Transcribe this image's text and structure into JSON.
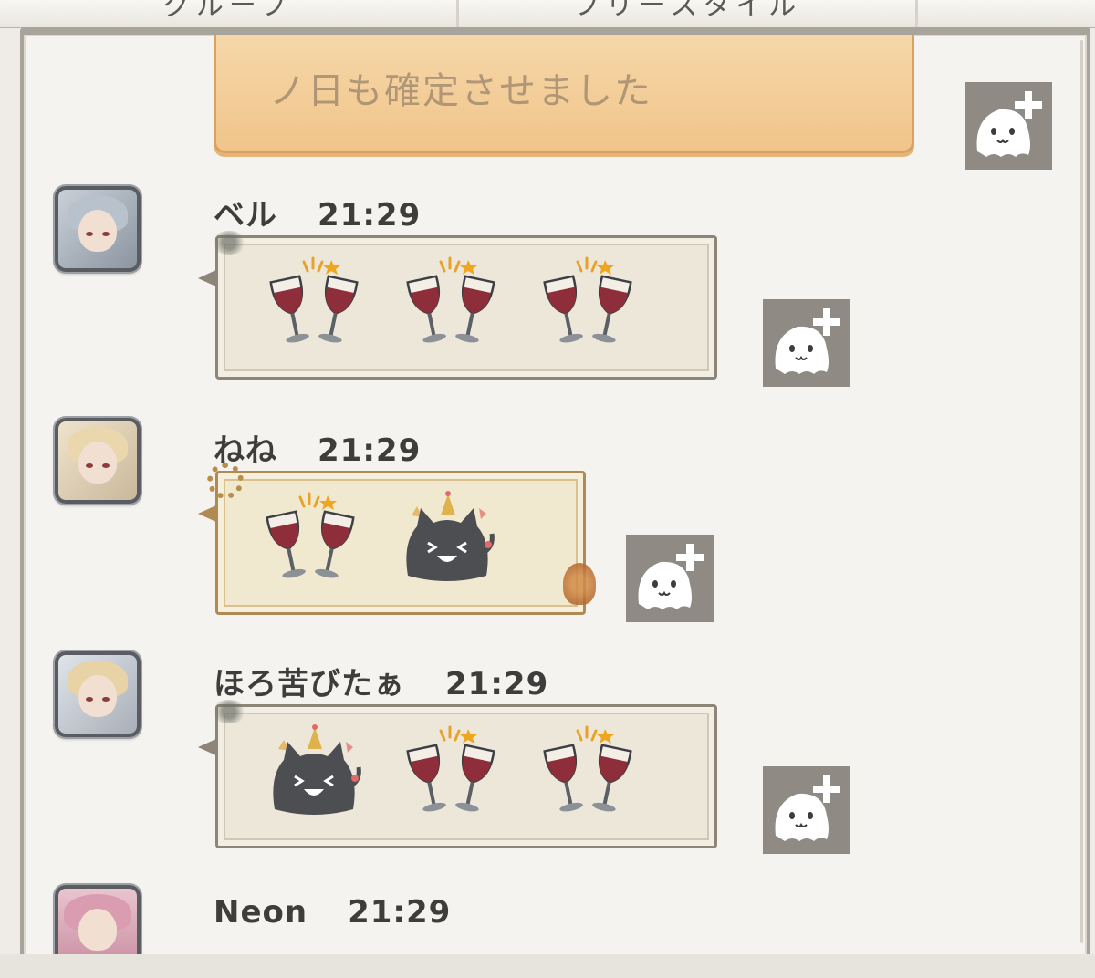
{
  "tabs": [
    {
      "label": "グループ"
    },
    {
      "label": "フリースタイル"
    },
    {
      "label": ""
    }
  ],
  "previous_message": {
    "text": "ノ日も確定させました"
  },
  "messages": [
    {
      "sender": "ベル",
      "time": "21:29",
      "stamps": [
        "wine-toast-stamp",
        "wine-toast-stamp",
        "wine-toast-stamp"
      ]
    },
    {
      "sender": "ねね",
      "time": "21:29",
      "stamps": [
        "wine-toast-stamp",
        "party-cat-stamp"
      ]
    },
    {
      "sender": "ほろ苦びたぁ",
      "time": "21:29",
      "stamps": [
        "party-cat-stamp",
        "wine-toast-stamp",
        "wine-toast-stamp"
      ]
    },
    {
      "sender": "Neon",
      "time": "21:29",
      "stamps": []
    }
  ],
  "react_button": {
    "icon": "ghost-plus-icon"
  },
  "colors": {
    "wine": "#8d2e3a",
    "bubble_border": "#8d8578",
    "accent_orange": "#f1c48a"
  }
}
